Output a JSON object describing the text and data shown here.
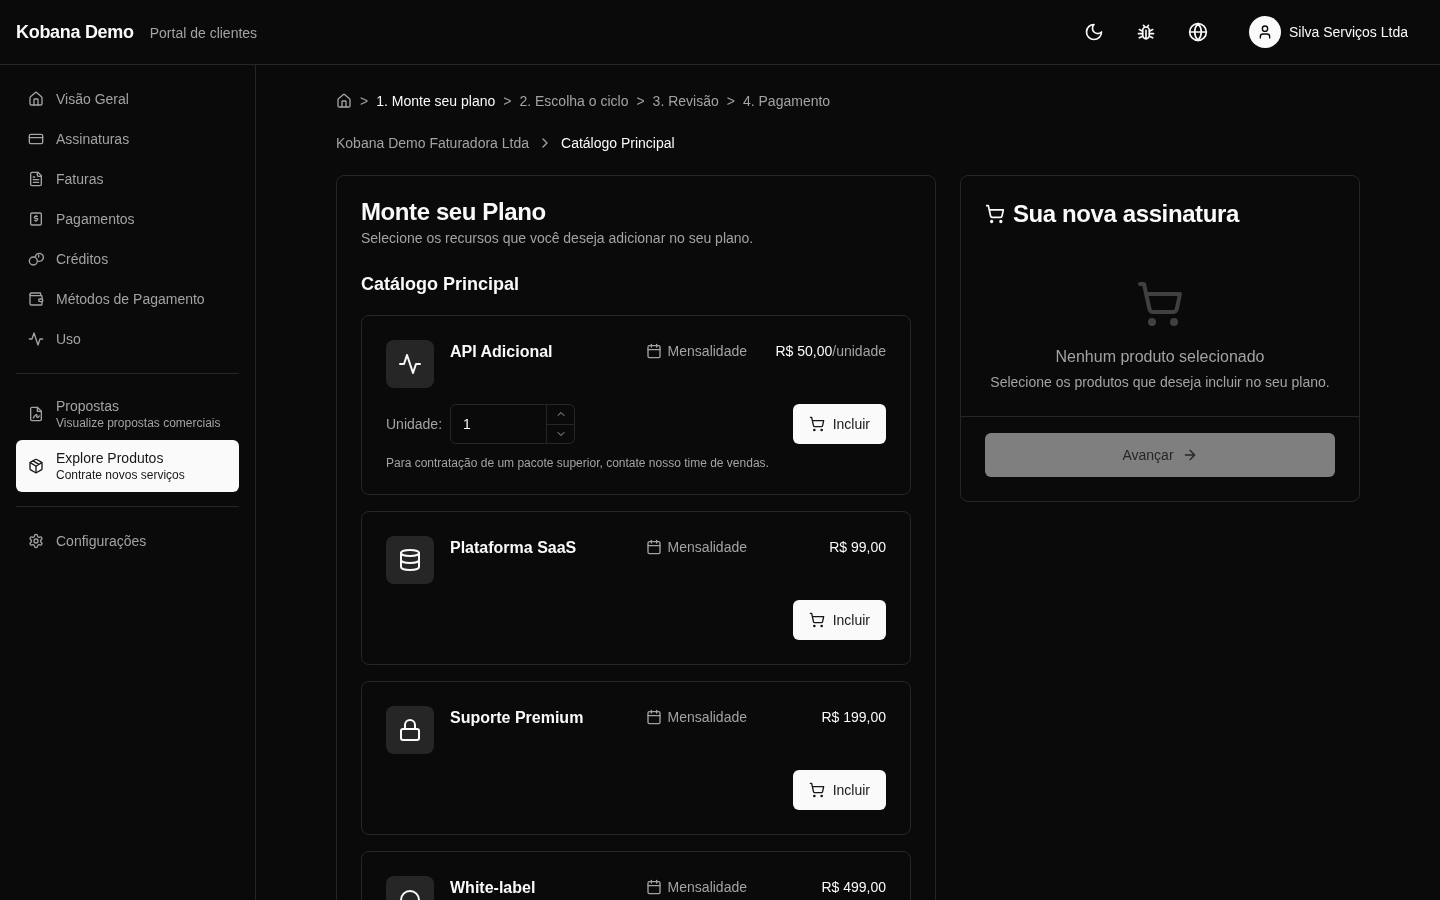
{
  "header": {
    "brand": "Kobana Demo",
    "subtitle": "Portal de clientes",
    "user": "Silva Serviços Ltda"
  },
  "sidebar": {
    "groups": [
      [
        {
          "kind": "house",
          "label": "Visão Geral",
          "selected": false
        },
        {
          "kind": "card",
          "label": "Assinaturas",
          "selected": false
        },
        {
          "kind": "file",
          "label": "Faturas",
          "selected": false
        },
        {
          "kind": "receipt",
          "label": "Pagamentos",
          "selected": false
        },
        {
          "kind": "coins",
          "label": "Créditos",
          "selected": false
        },
        {
          "kind": "wallet",
          "label": "Métodos de Pagamento",
          "selected": false
        },
        {
          "kind": "activity",
          "label": "Uso",
          "selected": false
        }
      ],
      [
        {
          "kind": "signature",
          "label": "Propostas",
          "subtitle": "Visualize propostas comerciais",
          "selected": false
        },
        {
          "kind": "package",
          "label": "Explore Produtos",
          "subtitle": "Contrate novos serviços",
          "selected": true
        }
      ],
      [
        {
          "kind": "gear",
          "label": "Configurações",
          "selected": false
        }
      ]
    ]
  },
  "steps": [
    {
      "separator": ">",
      "label": "1. Monte seu plano",
      "selected": true
    },
    {
      "separator": ">",
      "label": "2. Escolha o ciclo",
      "selected": false
    },
    {
      "separator": ">",
      "label": "3. Revisão",
      "selected": false
    },
    {
      "separator": ">",
      "label": "4. Pagamento",
      "selected": false
    }
  ],
  "breadcrumb": [
    "Kobana Demo Faturadora Ltda",
    "Catálogo Principal"
  ],
  "plan": {
    "title": "Monte seu Plano",
    "subtitle": "Selecione os recursos que você deseja adicionar no seu plano.",
    "catalog_title": "Catálogo Principal",
    "products": [
      {
        "kind": "activity",
        "name": "API Adicional",
        "billing": "Mensalidade",
        "price": "R$ 50,00",
        "unit": "/unidade",
        "quantity": {
          "label": "Unidade:",
          "value": "1"
        },
        "note": "Para contratação de um pacote superior, contate nosso time de vendas.",
        "button": "Incluir"
      },
      {
        "kind": "database",
        "name": "Plataforma SaaS",
        "billing": "Mensalidade",
        "price": "R$ 99,00",
        "button": "Incluir"
      },
      {
        "kind": "lock",
        "name": "Suporte Premium",
        "billing": "Mensalidade",
        "price": "R$ 199,00",
        "button": "Incluir"
      },
      {
        "kind": "circle",
        "name": "White-label",
        "billing": "Mensalidade",
        "price": "R$ 499,00"
      }
    ]
  },
  "cart": {
    "title": "Sua nova assinatura",
    "empty_title": "Nenhum produto selecionado",
    "empty_text": "Selecione os produtos que deseja incluir no seu plano.",
    "button": {
      "label": "Avançar",
      "disabled": true
    }
  }
}
